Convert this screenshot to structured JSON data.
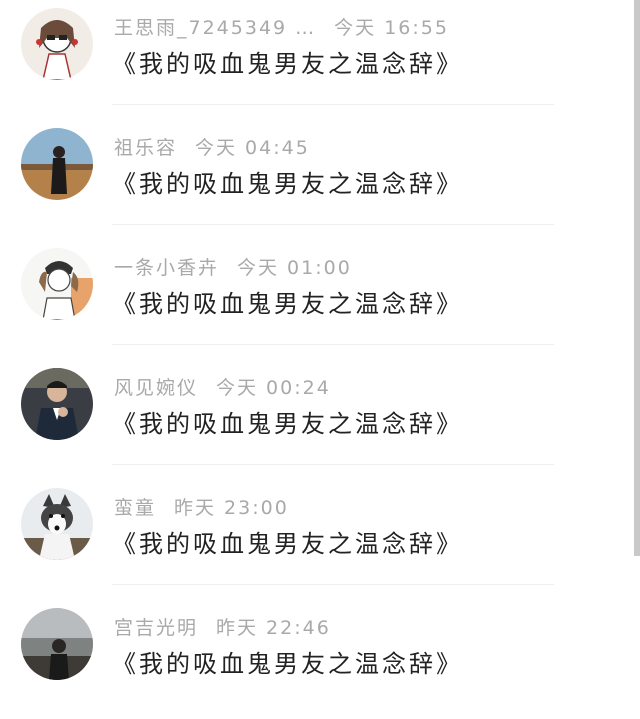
{
  "comments": [
    {
      "user": "王思雨_7245349 …",
      "time": "今天 16:55",
      "text": "《我的吸血鬼男友之温念辞》",
      "avatar_icon": "girl-sunglasses-avatar"
    },
    {
      "user": "祖乐容",
      "time": "今天 04:45",
      "text": "《我的吸血鬼男友之温念辞》",
      "avatar_icon": "woman-landscape-avatar"
    },
    {
      "user": "一条小香卉",
      "time": "今天 01:00",
      "text": "《我的吸血鬼男友之温念辞》",
      "avatar_icon": "anime-girl-cap-avatar"
    },
    {
      "user": "风见婉仪",
      "time": "今天 00:24",
      "text": "《我的吸血鬼男友之温念辞》",
      "avatar_icon": "man-suit-avatar"
    },
    {
      "user": "蛮童",
      "time": "昨天 23:00",
      "text": "《我的吸血鬼男友之温念辞》",
      "avatar_icon": "husky-dog-avatar"
    },
    {
      "user": "宫吉光明",
      "time": "昨天 22:46",
      "text": "《我的吸血鬼男友之温念辞》",
      "avatar_icon": "person-outdoor-avatar"
    }
  ],
  "colors": {
    "username": "#a9a9a9",
    "comment_text": "#222222",
    "divider": "#f0f0f0"
  }
}
